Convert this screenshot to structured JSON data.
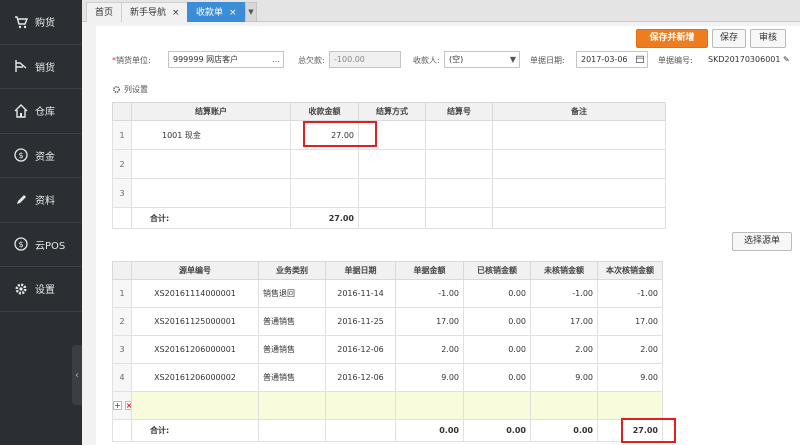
{
  "sidebar": {
    "items": [
      {
        "label": "购货",
        "icon": "cart-icon"
      },
      {
        "label": "销货",
        "icon": "sales-icon"
      },
      {
        "label": "仓库",
        "icon": "warehouse-icon"
      },
      {
        "label": "资金",
        "icon": "money-icon"
      },
      {
        "label": "资料",
        "icon": "pencil-icon"
      },
      {
        "label": "云POS",
        "icon": "cloud-pos-icon"
      },
      {
        "label": "设置",
        "icon": "gear-icon"
      }
    ],
    "collapse_glyph": "‹"
  },
  "tabs": [
    {
      "label": "首页",
      "closable": false,
      "active": false
    },
    {
      "label": "新手导航",
      "closable": true,
      "active": false
    },
    {
      "label": "收款单",
      "closable": true,
      "active": true
    }
  ],
  "tab_more_glyph": "▼",
  "close_glyph": "×",
  "actions": {
    "save_new": "保存并新增",
    "save": "保存",
    "audit": "审核"
  },
  "form": {
    "unit_label": "销货单位:",
    "unit_required": "*",
    "unit_value": "999999 网店客户",
    "unit_more": "…",
    "arrears_label": "总欠款:",
    "arrears_value": "-100.00",
    "payee_label": "收款人:",
    "payee_value": "(空)",
    "date_label": "单据日期:",
    "date_value": "2017-03-06",
    "docno_label": "单据编号:",
    "docno_value": "SKD20170306001"
  },
  "column_settings_label": "列设置",
  "settlement_table": {
    "headers": [
      "",
      "结算账户",
      "收款金额",
      "结算方式",
      "结算号",
      "备注"
    ],
    "rows": [
      {
        "idx": "1",
        "account": "1001 现金",
        "amount": "27.00",
        "method": "",
        "number": "",
        "note": ""
      },
      {
        "idx": "2",
        "account": "",
        "amount": "",
        "method": "",
        "number": "",
        "note": ""
      },
      {
        "idx": "3",
        "account": "",
        "amount": "",
        "method": "",
        "number": "",
        "note": ""
      }
    ],
    "total_label": "合计:",
    "total_amount": "27.00"
  },
  "select_source_label": "选择源单",
  "source_table": {
    "headers": [
      "",
      "源单编号",
      "业务类别",
      "单据日期",
      "单据金额",
      "已核销金额",
      "未核销金额",
      "本次核销金额"
    ],
    "rows": [
      {
        "idx": "1",
        "no": "XS20161114000001",
        "type": "销售退回",
        "date": "2016-11-14",
        "amount": "-1.00",
        "verified": "0.00",
        "unverified": "-1.00",
        "current": "-1.00"
      },
      {
        "idx": "2",
        "no": "XS20161125000001",
        "type": "普通销售",
        "date": "2016-11-25",
        "amount": "17.00",
        "verified": "0.00",
        "unverified": "17.00",
        "current": "17.00"
      },
      {
        "idx": "3",
        "no": "XS20161206000001",
        "type": "普通销售",
        "date": "2016-12-06",
        "amount": "2.00",
        "verified": "0.00",
        "unverified": "2.00",
        "current": "2.00"
      },
      {
        "idx": "4",
        "no": "XS20161206000002",
        "type": "普通销售",
        "date": "2016-12-06",
        "amount": "9.00",
        "verified": "0.00",
        "unverified": "9.00",
        "current": "9.00"
      }
    ],
    "add_glyph": "+",
    "remove_glyph": "×",
    "total_label": "合计:",
    "total_amount": "0.00",
    "total_verified": "0.00",
    "total_unverified": "0.00",
    "total_current": "27.00"
  }
}
